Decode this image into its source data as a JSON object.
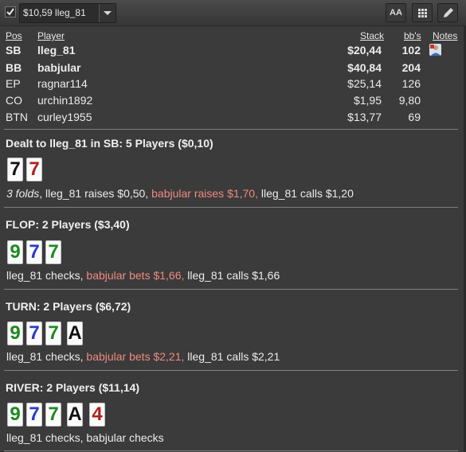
{
  "toolbar": {
    "hand_select_value": "$10,59 lleg_81",
    "font_button_label": "AA"
  },
  "table": {
    "headers": {
      "pos": "Pos",
      "player": "Player",
      "stack": "Stack",
      "bbs": "bb's",
      "notes": "Notes"
    },
    "rows": [
      {
        "pos": "SB",
        "player": "lleg_81",
        "stack": "$20,44",
        "bbs": "102",
        "bold": true,
        "has_note": true
      },
      {
        "pos": "BB",
        "player": "babjular",
        "stack": "$40,84",
        "bbs": "204",
        "bold": true,
        "has_note": false
      },
      {
        "pos": "EP",
        "player": "ragnar114",
        "stack": "$25,14",
        "bbs": "126",
        "bold": false,
        "has_note": false
      },
      {
        "pos": "CO",
        "player": "urchin1892",
        "stack": "$1,95",
        "bbs": "9,80",
        "bold": false,
        "has_note": false
      },
      {
        "pos": "BTN",
        "player": "curley1955",
        "stack": "$13,77",
        "bbs": "69",
        "bold": false,
        "has_note": false
      }
    ]
  },
  "streets": [
    {
      "title": "Dealt to lleg_81 in SB: 5 Players ($0,10)",
      "cards": [
        {
          "rank": "7",
          "color": "#111111"
        },
        {
          "rank": "7",
          "color": "#b0201c"
        }
      ],
      "action": [
        {
          "text": "3 folds",
          "style": "italic"
        },
        {
          "text": ", lleg_81 raises $0,50, ",
          "style": "normal"
        },
        {
          "text": "babjular raises $1,70,",
          "style": "pink"
        },
        {
          "text": " lleg_81 calls $1,20",
          "style": "normal"
        }
      ]
    },
    {
      "title": "FLOP: 2 Players ($3,40)",
      "cards": [
        {
          "rank": "9",
          "color": "#1c8a1c"
        },
        {
          "rank": "7",
          "color": "#2a3ac8"
        },
        {
          "rank": "7",
          "color": "#1c8a1c"
        }
      ],
      "action": [
        {
          "text": "lleg_81 checks, ",
          "style": "normal"
        },
        {
          "text": "babjular bets $1,66,",
          "style": "pink"
        },
        {
          "text": " lleg_81 calls $1,66",
          "style": "normal"
        }
      ]
    },
    {
      "title": "TURN: 2 Players ($6,72)",
      "cards": [
        {
          "rank": "9",
          "color": "#1c8a1c"
        },
        {
          "rank": "7",
          "color": "#2a3ac8"
        },
        {
          "rank": "7",
          "color": "#1c8a1c"
        },
        {
          "rank": "A",
          "color": "#111111"
        }
      ],
      "action": [
        {
          "text": "lleg_81 checks, ",
          "style": "normal"
        },
        {
          "text": "babjular bets $2,21,",
          "style": "pink"
        },
        {
          "text": " lleg_81 calls $2,21",
          "style": "normal"
        }
      ]
    },
    {
      "title": "RIVER: 2 Players ($11,14)",
      "cards": [
        {
          "rank": "9",
          "color": "#1c8a1c"
        },
        {
          "rank": "7",
          "color": "#2a3ac8"
        },
        {
          "rank": "7",
          "color": "#1c8a1c"
        },
        {
          "rank": "A",
          "color": "#111111"
        },
        {
          "rank": "4",
          "color": "#b0201c"
        }
      ],
      "action": [
        {
          "text": "lleg_81 checks, babjular checks",
          "style": "normal"
        }
      ]
    }
  ]
}
